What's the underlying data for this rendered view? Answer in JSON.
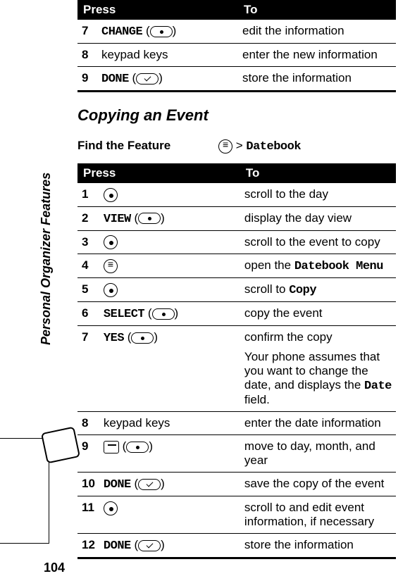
{
  "page_number": "104",
  "sidebar_label": "Personal Organizer Features",
  "table1": {
    "headers": {
      "press": "Press",
      "to": "To"
    },
    "rows": [
      {
        "num": "7",
        "press_label": "CHANGE",
        "press_icon": "softkey-right",
        "to": "edit the information"
      },
      {
        "num": "8",
        "press_label": "keypad keys",
        "press_icon": "",
        "to": "enter the new information"
      },
      {
        "num": "9",
        "press_label": "DONE",
        "press_icon": "softkey-left",
        "to": "store the information"
      }
    ]
  },
  "section_title": "Copying an Event",
  "feature": {
    "label": "Find the Feature",
    "menu_icon": "menu-key",
    "sep": ">",
    "path": "Datebook"
  },
  "table2": {
    "headers": {
      "press": "Press",
      "to": "To"
    },
    "rows": [
      {
        "num": "1",
        "press_label": "",
        "press_icon": "nav-key",
        "to": "scroll to the day"
      },
      {
        "num": "2",
        "press_label": "VIEW",
        "press_icon": "softkey-right",
        "to": "display the day view"
      },
      {
        "num": "3",
        "press_label": "",
        "press_icon": "nav-key",
        "to": "scroll to the event to copy"
      },
      {
        "num": "4",
        "press_label": "",
        "press_icon": "menu-key",
        "to": "open the ",
        "to_mono": "Datebook Menu"
      },
      {
        "num": "5",
        "press_label": "",
        "press_icon": "nav-key",
        "to": "scroll to ",
        "to_mono": "Copy"
      },
      {
        "num": "6",
        "press_label": "SELECT",
        "press_icon": "softkey-right",
        "to": "copy the event"
      },
      {
        "num": "7",
        "press_label": "YES",
        "press_icon": "softkey-right",
        "to": "confirm the copy",
        "sub": "Your phone assumes that you want to change the date, and displays the ",
        "sub_mono": "Date",
        "sub_after": " field."
      },
      {
        "num": "8",
        "press_label": "keypad keys",
        "press_icon": "",
        "to": "enter the date information"
      },
      {
        "num": "9",
        "press_label": "",
        "press_icon": "cal-key",
        "press_icon2": "softkey-right",
        "to": "move to day, month, and year"
      },
      {
        "num": "10",
        "press_label": "DONE",
        "press_icon": "softkey-left",
        "to": "save the copy of the event"
      },
      {
        "num": "11",
        "press_label": "",
        "press_icon": "nav-key",
        "to": "scroll to and edit event information, if necessary"
      },
      {
        "num": "12",
        "press_label": "DONE",
        "press_icon": "softkey-left",
        "to": "store the information"
      }
    ]
  }
}
